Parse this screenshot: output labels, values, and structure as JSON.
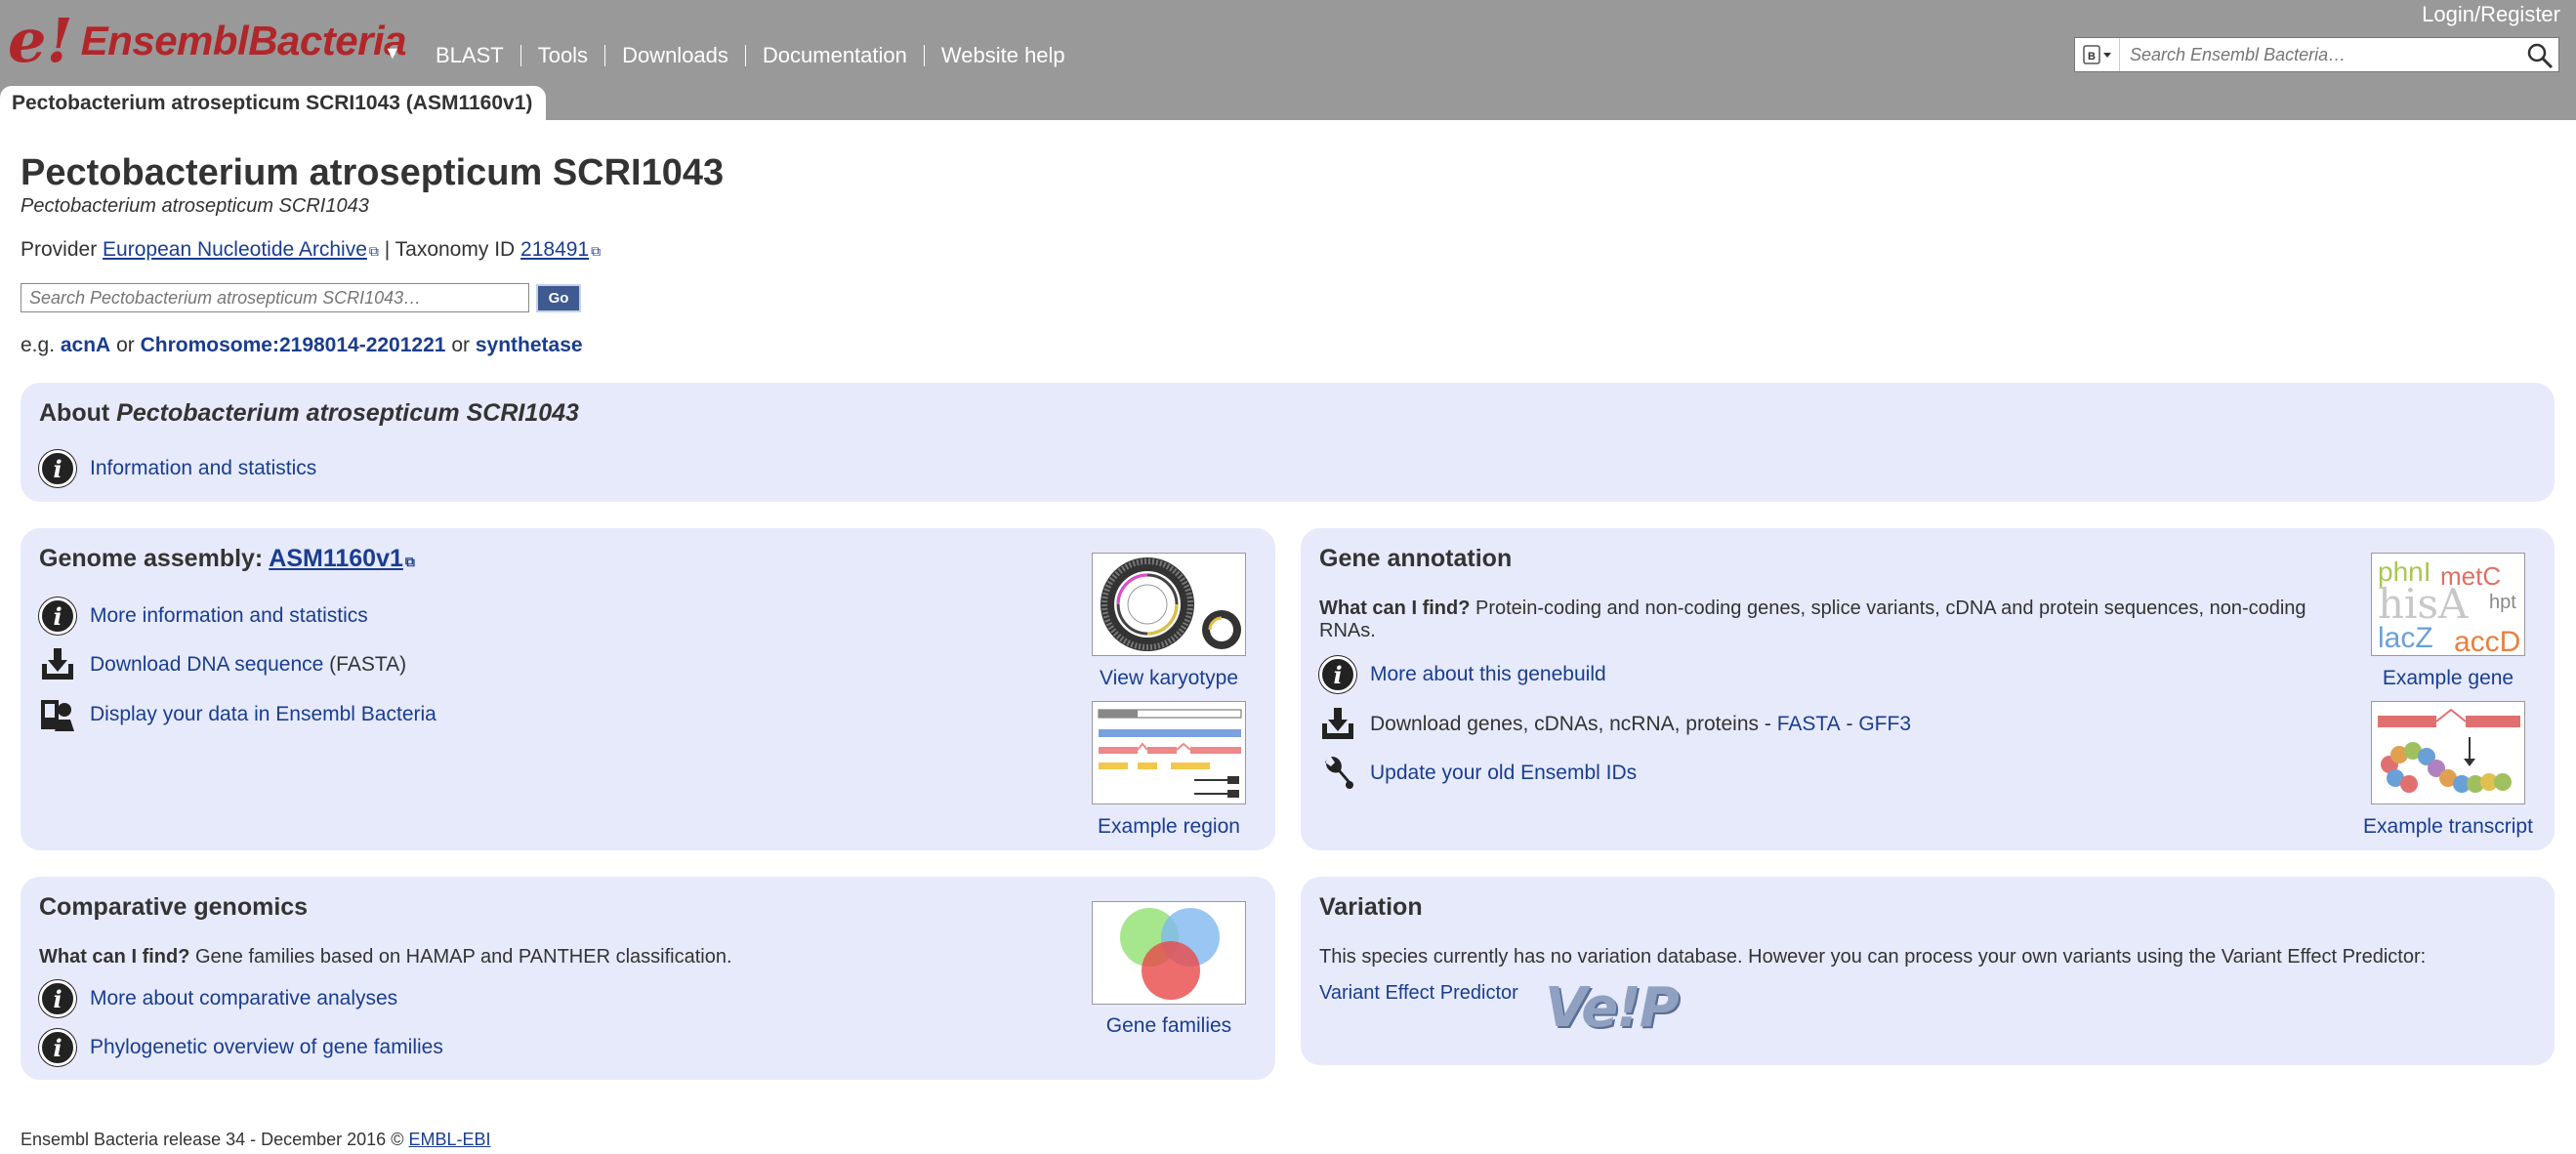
{
  "header": {
    "logo_e": "e!",
    "logo_text": "EnsemblBacteria",
    "nav": [
      "BLAST",
      "Tools",
      "Downloads",
      "Documentation",
      "Website help"
    ],
    "login": "Login/Register",
    "search_placeholder": "Search Ensembl Bacteria…",
    "species_tab": "Pectobacterium atrosepticum SCRI1043 (ASM1160v1)"
  },
  "species": {
    "title": "Pectobacterium atrosepticum SCRI1043",
    "subtitle": "Pectobacterium atrosepticum SCRI1043",
    "provider_label": "Provider",
    "provider_link": "European Nucleotide Archive",
    "taxonomy_label": "| Taxonomy ID",
    "taxonomy_id": "218491",
    "search_placeholder": "Search Pectobacterium atrosepticum SCRI1043…",
    "go_label": "Go",
    "eg_label": "e.g.",
    "eg_1": "acnA",
    "or_1": "or",
    "eg_2": "Chromosome:2198014-2201221",
    "or_2": "or",
    "eg_3": "synthetase"
  },
  "about": {
    "title_prefix": "About",
    "title_species": "Pectobacterium atrosepticum SCRI1043",
    "link": "Information and statistics"
  },
  "genome": {
    "title_prefix": "Genome assembly:",
    "assembly": "ASM1160v1",
    "more_info": "More information and statistics",
    "download": "Download DNA sequence",
    "download_suffix": "(FASTA)",
    "display": "Display your data in Ensembl Bacteria",
    "karyotype_label": "View karyotype",
    "region_label": "Example region"
  },
  "gene_annotation": {
    "title": "Gene annotation",
    "what_label": "What can I find?",
    "what_text": "Protein-coding and non-coding genes, splice variants, cDNA and protein sequences, non-coding RNAs.",
    "more": "More about this genebuild",
    "download_prefix": "Download genes, cDNAs, ncRNA, proteins -",
    "fasta": "FASTA",
    "dash": "-",
    "gff3": "GFF3",
    "update": "Update your old Ensembl IDs",
    "example_gene": "Example gene",
    "example_transcript": "Example transcript",
    "gene_words": [
      "phnI",
      "metC",
      "hisA",
      "hpt",
      "lacZ",
      "accD"
    ]
  },
  "comparative": {
    "title": "Comparative genomics",
    "what_label": "What can I find?",
    "what_text": "Gene families based on HAMAP and PANTHER classification.",
    "more": "More about comparative analyses",
    "phylo": "Phylogenetic overview of gene families",
    "families_label": "Gene families"
  },
  "variation": {
    "title": "Variation",
    "text": "This species currently has no variation database. However you can process your own variants using the Variant Effect Predictor:",
    "vep_link": "Variant Effect Predictor",
    "vep_logo": "Ve!P"
  },
  "footer": {
    "text": "Ensembl Bacteria release 34 - December 2016 ©",
    "link": "EMBL-EBI"
  }
}
